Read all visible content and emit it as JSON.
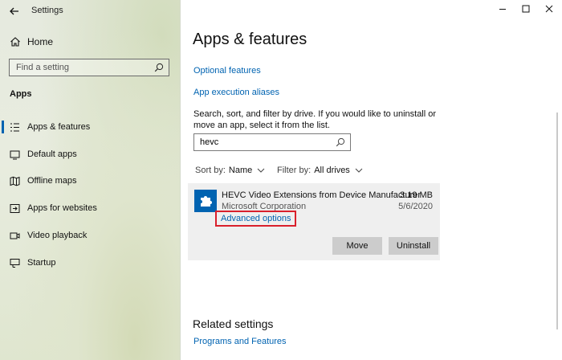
{
  "window": {
    "title": "Settings"
  },
  "sidebar": {
    "home_label": "Home",
    "search_placeholder": "Find a setting",
    "section_title": "Apps",
    "items": [
      {
        "label": "Apps & features",
        "icon": "list-icon",
        "selected": true
      },
      {
        "label": "Default apps",
        "icon": "default-apps-icon",
        "selected": false
      },
      {
        "label": "Offline maps",
        "icon": "map-icon",
        "selected": false
      },
      {
        "label": "Apps for websites",
        "icon": "website-app-icon",
        "selected": false
      },
      {
        "label": "Video playback",
        "icon": "video-icon",
        "selected": false
      },
      {
        "label": "Startup",
        "icon": "startup-icon",
        "selected": false
      }
    ]
  },
  "main": {
    "title": "Apps & features",
    "links": {
      "optional_features": "Optional features",
      "execution_aliases": "App execution aliases"
    },
    "description": "Search, sort, and filter by drive. If you would like to uninstall or move an app, select it from the list.",
    "search_value": "hevc",
    "sort_label": "Sort by:",
    "sort_value": "Name",
    "filter_label": "Filter by:",
    "filter_value": "All drives",
    "app": {
      "name": "HEVC Video Extensions from Device Manufacturer",
      "publisher": "Microsoft Corporation",
      "size": "3.19 MB",
      "date": "5/6/2020",
      "advanced_options": "Advanced options",
      "move_label": "Move",
      "uninstall_label": "Uninstall"
    },
    "related_title": "Related settings",
    "related_link": "Programs and Features"
  },
  "colors": {
    "accent": "#0063b1",
    "highlight_box": "#d9202c",
    "button_bg": "#cccccc"
  }
}
